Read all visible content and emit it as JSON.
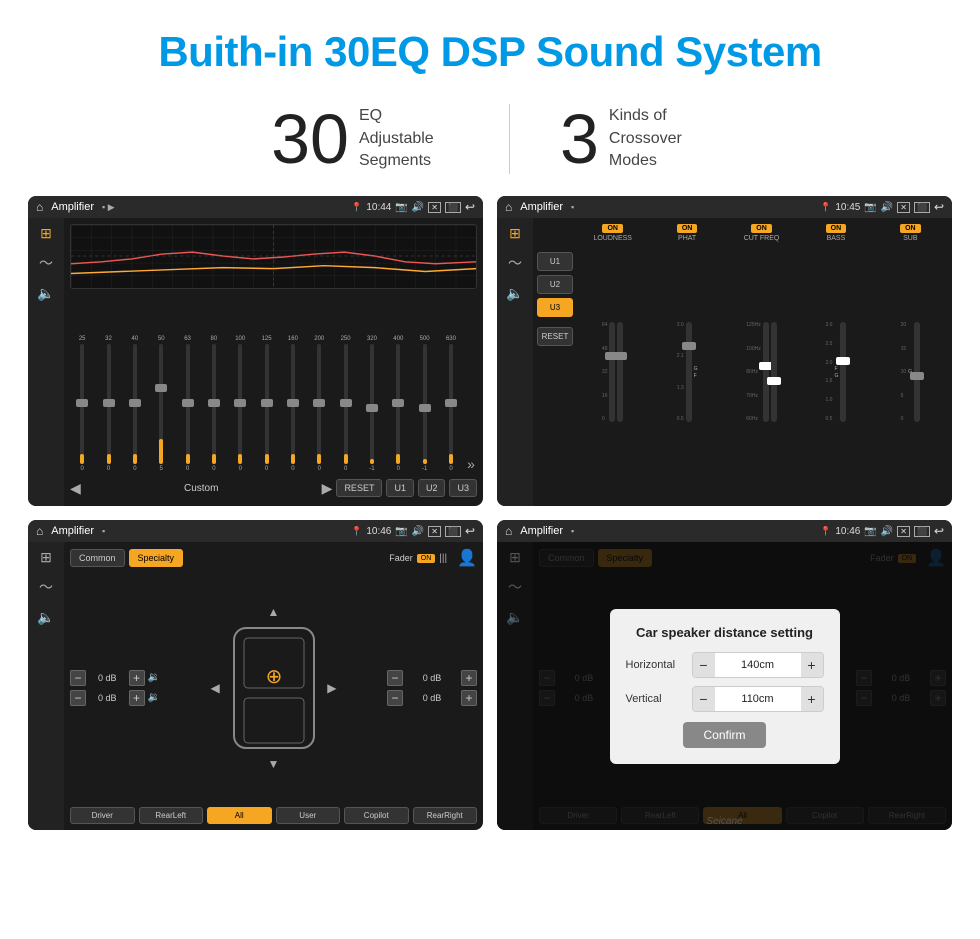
{
  "page": {
    "title": "Buith-in 30EQ DSP Sound System",
    "stat1_number": "30",
    "stat1_label": "EQ Adjustable\nSegments",
    "stat2_number": "3",
    "stat2_label": "Kinds of\nCrossover Modes"
  },
  "screen1": {
    "title": "Amplifier",
    "time": "10:44",
    "mode": "Custom",
    "freqs": [
      "25",
      "32",
      "40",
      "50",
      "63",
      "80",
      "100",
      "125",
      "160",
      "200",
      "250",
      "320",
      "400",
      "500",
      "630"
    ],
    "values": [
      "0",
      "0",
      "0",
      "5",
      "0",
      "0",
      "0",
      "0",
      "0",
      "0",
      "0",
      "-1",
      "0",
      "-1"
    ],
    "sliders": [
      50,
      50,
      50,
      70,
      50,
      50,
      50,
      50,
      50,
      50,
      50,
      40,
      50,
      40
    ],
    "buttons": [
      "RESET",
      "U1",
      "U2",
      "U3"
    ]
  },
  "screen2": {
    "title": "Amplifier",
    "time": "10:45",
    "modes": [
      "LOUDNESS",
      "PHAT",
      "CUT FREQ",
      "BASS",
      "SUB"
    ],
    "all_on": true,
    "u_buttons": [
      "U1",
      "U2",
      "U3"
    ],
    "active_u": "U3",
    "reset_label": "RESET"
  },
  "screen3": {
    "title": "Amplifier",
    "time": "10:46",
    "mode_common": "Common",
    "mode_specialty": "Specialty",
    "fader_label": "Fader",
    "fader_on": "ON",
    "db_values": [
      "0 dB",
      "0 dB",
      "0 dB",
      "0 dB"
    ],
    "buttons": [
      "Driver",
      "RearLeft",
      "All",
      "User",
      "Copilot",
      "RearRight"
    ]
  },
  "screen4": {
    "title": "Amplifier",
    "time": "10:46",
    "dialog": {
      "title": "Car speaker distance setting",
      "horizontal_label": "Horizontal",
      "horizontal_value": "140cm",
      "vertical_label": "Vertical",
      "vertical_value": "110cm",
      "confirm_label": "Confirm"
    },
    "db_values": [
      "0 dB",
      "0 dB"
    ],
    "buttons": [
      "Driver",
      "RearLeft",
      "All",
      "Copilot",
      "RearRight"
    ]
  }
}
